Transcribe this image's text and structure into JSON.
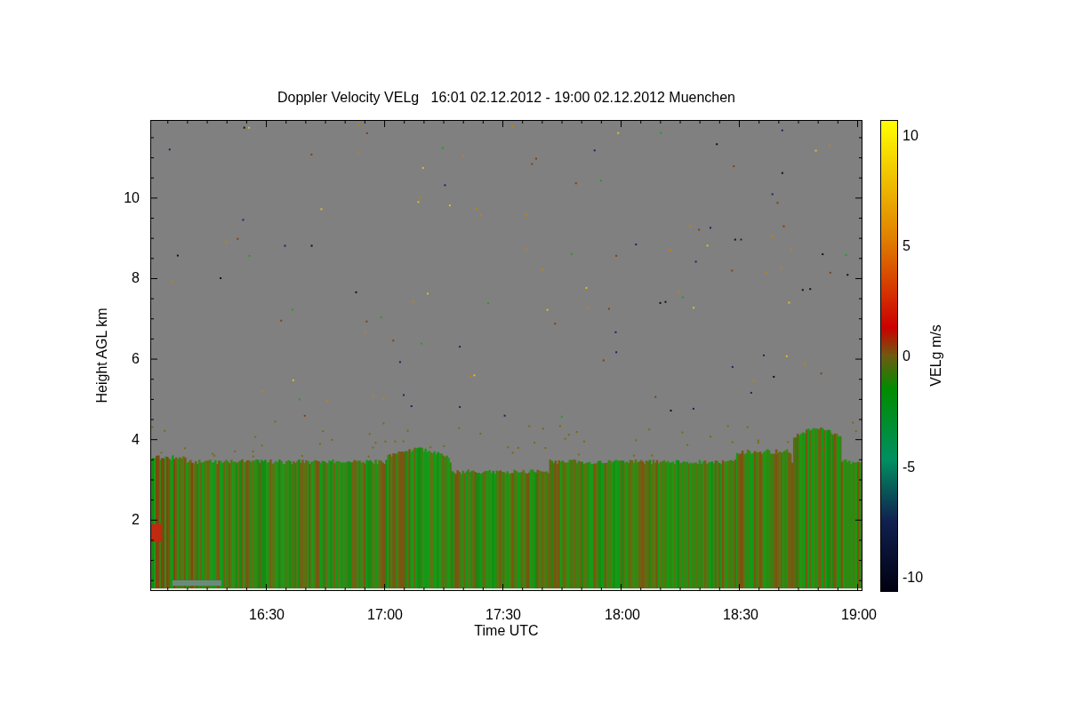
{
  "figure": {
    "title": "Doppler Velocity VELg   16:01 02.12.2012 - 19:00 02.12.2012 Muenchen",
    "xlabel": "Time UTC",
    "ylabel": "Height AGL km",
    "xticks": [
      "16:30",
      "17:00",
      "17:30",
      "18:00",
      "18:30",
      "19:00"
    ],
    "yticks": [
      "10",
      "8",
      "6",
      "4",
      "2"
    ]
  },
  "colorbar": {
    "label": "VELg m/s",
    "ticks": [
      "10",
      "5",
      "0",
      "-5",
      "-10"
    ]
  }
}
